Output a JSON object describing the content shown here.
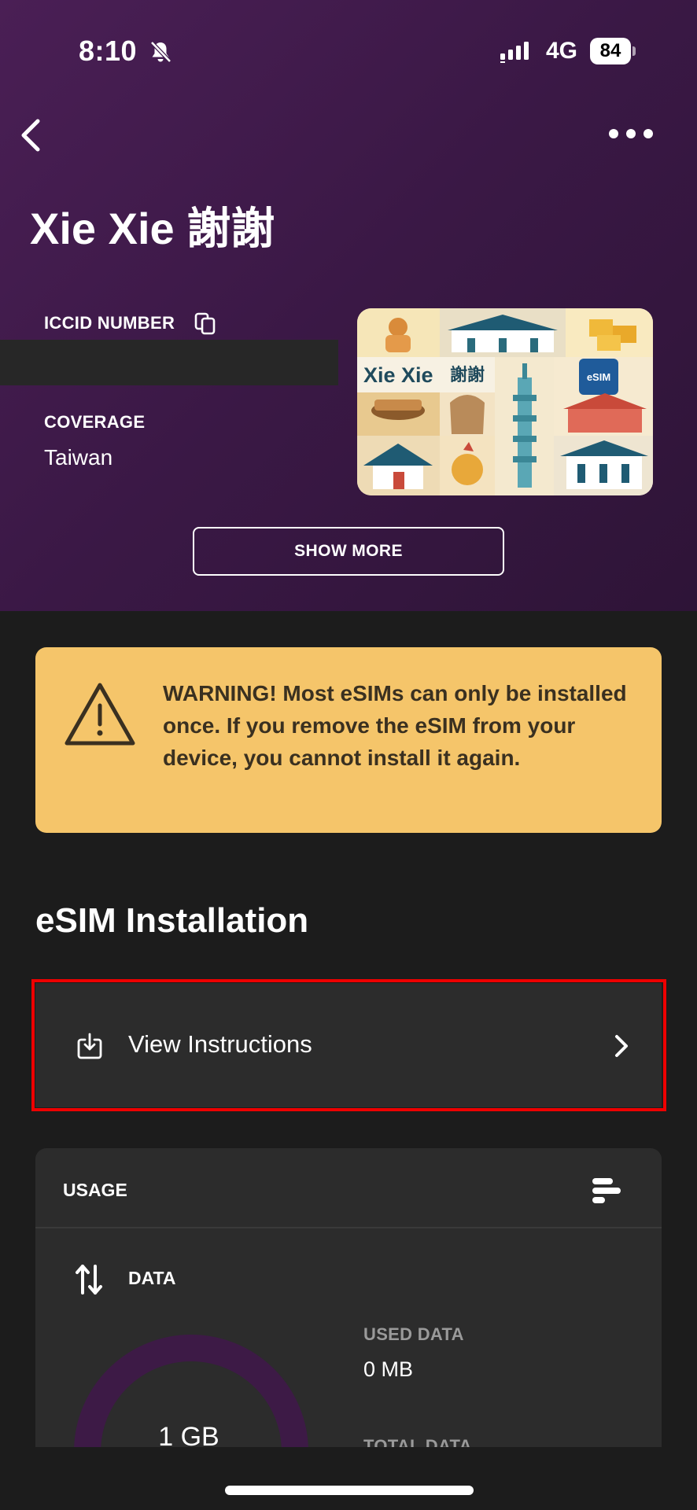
{
  "status_bar": {
    "time": "8:10",
    "network": "4G",
    "battery": "84"
  },
  "header": {
    "title": "Xie Xie 謝謝"
  },
  "esim_details": {
    "iccid_label": "ICCID NUMBER",
    "coverage_label": "COVERAGE",
    "coverage_value": "Taiwan",
    "card_title": "Xie Xie",
    "card_title_cjk": "謝謝",
    "card_badge": "eSIM",
    "show_more_label": "SHOW MORE"
  },
  "warning": {
    "text": "WARNING! Most eSIMs can only be installed once. If you remove the eSIM from your device, you cannot install it again."
  },
  "installation": {
    "section_title": "eSIM Installation",
    "view_instructions_label": "View Instructions"
  },
  "usage": {
    "title": "USAGE",
    "data_label": "DATA",
    "donut_value": "1 GB",
    "used_fraction": 0,
    "used_data_label": "USED DATA",
    "used_data_value": "0 MB",
    "total_data_label": "TOTAL DATA"
  },
  "colors": {
    "hero_bg": "#3a1845",
    "warning_bg": "#f5c56a",
    "card_bg": "#2c2c2c",
    "highlight": "#ee0000",
    "donut_ring": "#3d1a46"
  },
  "icons": {
    "bell": "bell-slash-icon",
    "signal": "cell-signal-icon",
    "back": "chevron-left-icon",
    "more": "more-dots-icon",
    "copy": "copy-icon",
    "warning": "warning-triangle-icon",
    "download": "download-icon",
    "chevron": "chevron-right-icon",
    "chart": "bar-chart-icon",
    "data": "arrows-up-down-icon"
  }
}
